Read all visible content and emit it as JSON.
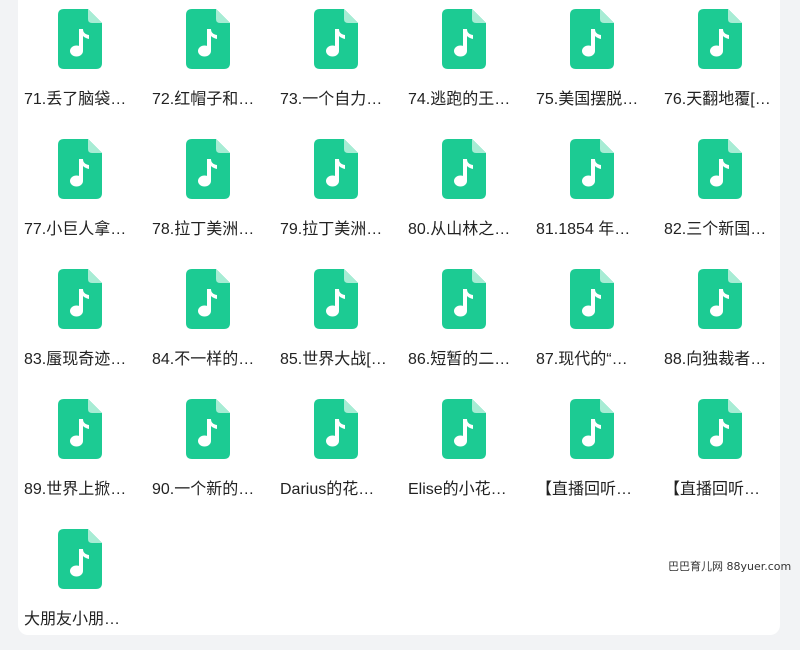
{
  "colors": {
    "icon_fill": "#1ccb93",
    "icon_fold": "#a7ecd4",
    "note": "#ffffff",
    "label": "#222222",
    "background": "#f2f3f5",
    "panel": "#ffffff"
  },
  "files": [
    {
      "name": "71.丢了脑袋…",
      "icon": "music-file-icon"
    },
    {
      "name": "72.红帽子和…",
      "icon": "music-file-icon"
    },
    {
      "name": "73.一个自力…",
      "icon": "music-file-icon"
    },
    {
      "name": "74.逃跑的王…",
      "icon": "music-file-icon"
    },
    {
      "name": "75.美国摆脱…",
      "icon": "music-file-icon"
    },
    {
      "name": "76.天翻地覆[…",
      "icon": "music-file-icon"
    },
    {
      "name": "77.小巨人拿…",
      "icon": "music-file-icon"
    },
    {
      "name": "78.拉丁美洲…",
      "icon": "music-file-icon"
    },
    {
      "name": "79.拉丁美洲…",
      "icon": "music-file-icon"
    },
    {
      "name": "80.从山林之…",
      "icon": "music-file-icon"
    },
    {
      "name": "81.1854 年…",
      "icon": "music-file-icon"
    },
    {
      "name": "82.三个新国…",
      "icon": "music-file-icon"
    },
    {
      "name": "83.蜃现奇迹…",
      "icon": "music-file-icon"
    },
    {
      "name": "84.不一样的…",
      "icon": "music-file-icon"
    },
    {
      "name": "85.世界大战[…",
      "icon": "music-file-icon"
    },
    {
      "name": "86.短暂的二…",
      "icon": "music-file-icon"
    },
    {
      "name": "87.现代的“…",
      "icon": "music-file-icon"
    },
    {
      "name": "88.向独裁者…",
      "icon": "music-file-icon"
    },
    {
      "name": "89.世界上掀…",
      "icon": "music-file-icon"
    },
    {
      "name": "90.一个新的…",
      "icon": "music-file-icon"
    },
    {
      "name": "Darius的花…",
      "icon": "music-file-icon"
    },
    {
      "name": "Elise的小花…",
      "icon": "music-file-icon"
    },
    {
      "name": "【直播回听…",
      "icon": "music-file-icon"
    },
    {
      "name": "【直播回听…",
      "icon": "music-file-icon"
    },
    {
      "name": "大朋友小朋…",
      "icon": "music-file-icon"
    }
  ],
  "watermark": {
    "text": "巴巴育儿网 88yuer.com"
  }
}
